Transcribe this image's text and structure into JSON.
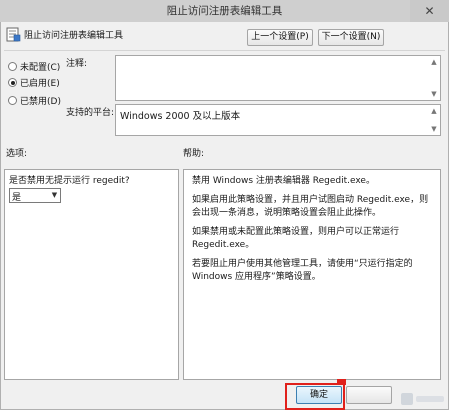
{
  "window": {
    "title": "阻止访问注册表编辑工具",
    "close_glyph": "✕"
  },
  "policy": {
    "name": "阻止访问注册表编辑工具"
  },
  "nav": {
    "prev_label": "上一个设置(P)",
    "next_label": "下一个设置(N)"
  },
  "state": {
    "options": [
      {
        "label": "未配置(C)",
        "checked": false
      },
      {
        "label": "已启用(E)",
        "checked": true
      },
      {
        "label": "已禁用(D)",
        "checked": false
      }
    ]
  },
  "comment": {
    "label": "注释:",
    "value": ""
  },
  "platform": {
    "label": "支持的平台:",
    "value": "Windows 2000 及以上版本"
  },
  "sections": {
    "options_label": "选项:",
    "help_label": "帮助:"
  },
  "options_panel": {
    "question": "是否禁用无提示运行 regedit?",
    "selected": "是"
  },
  "help": {
    "paragraphs": [
      "禁用 Windows 注册表编辑器 Regedit.exe。",
      "如果启用此策略设置，并且用户试图启动 Regedit.exe，则会出现一条消息，说明策略设置会阻止此操作。",
      "如果禁用或未配置此策略设置，则用户可以正常运行 Regedit.exe。",
      "若要阻止用户使用其他管理工具，请使用“只运行指定的 Windows 应用程序”策略设置。"
    ]
  },
  "footer": {
    "ok_label": "确定",
    "cancel_label": ""
  },
  "colors": {
    "highlight": "#e0201b",
    "ok_border": "#3c7fb1"
  }
}
